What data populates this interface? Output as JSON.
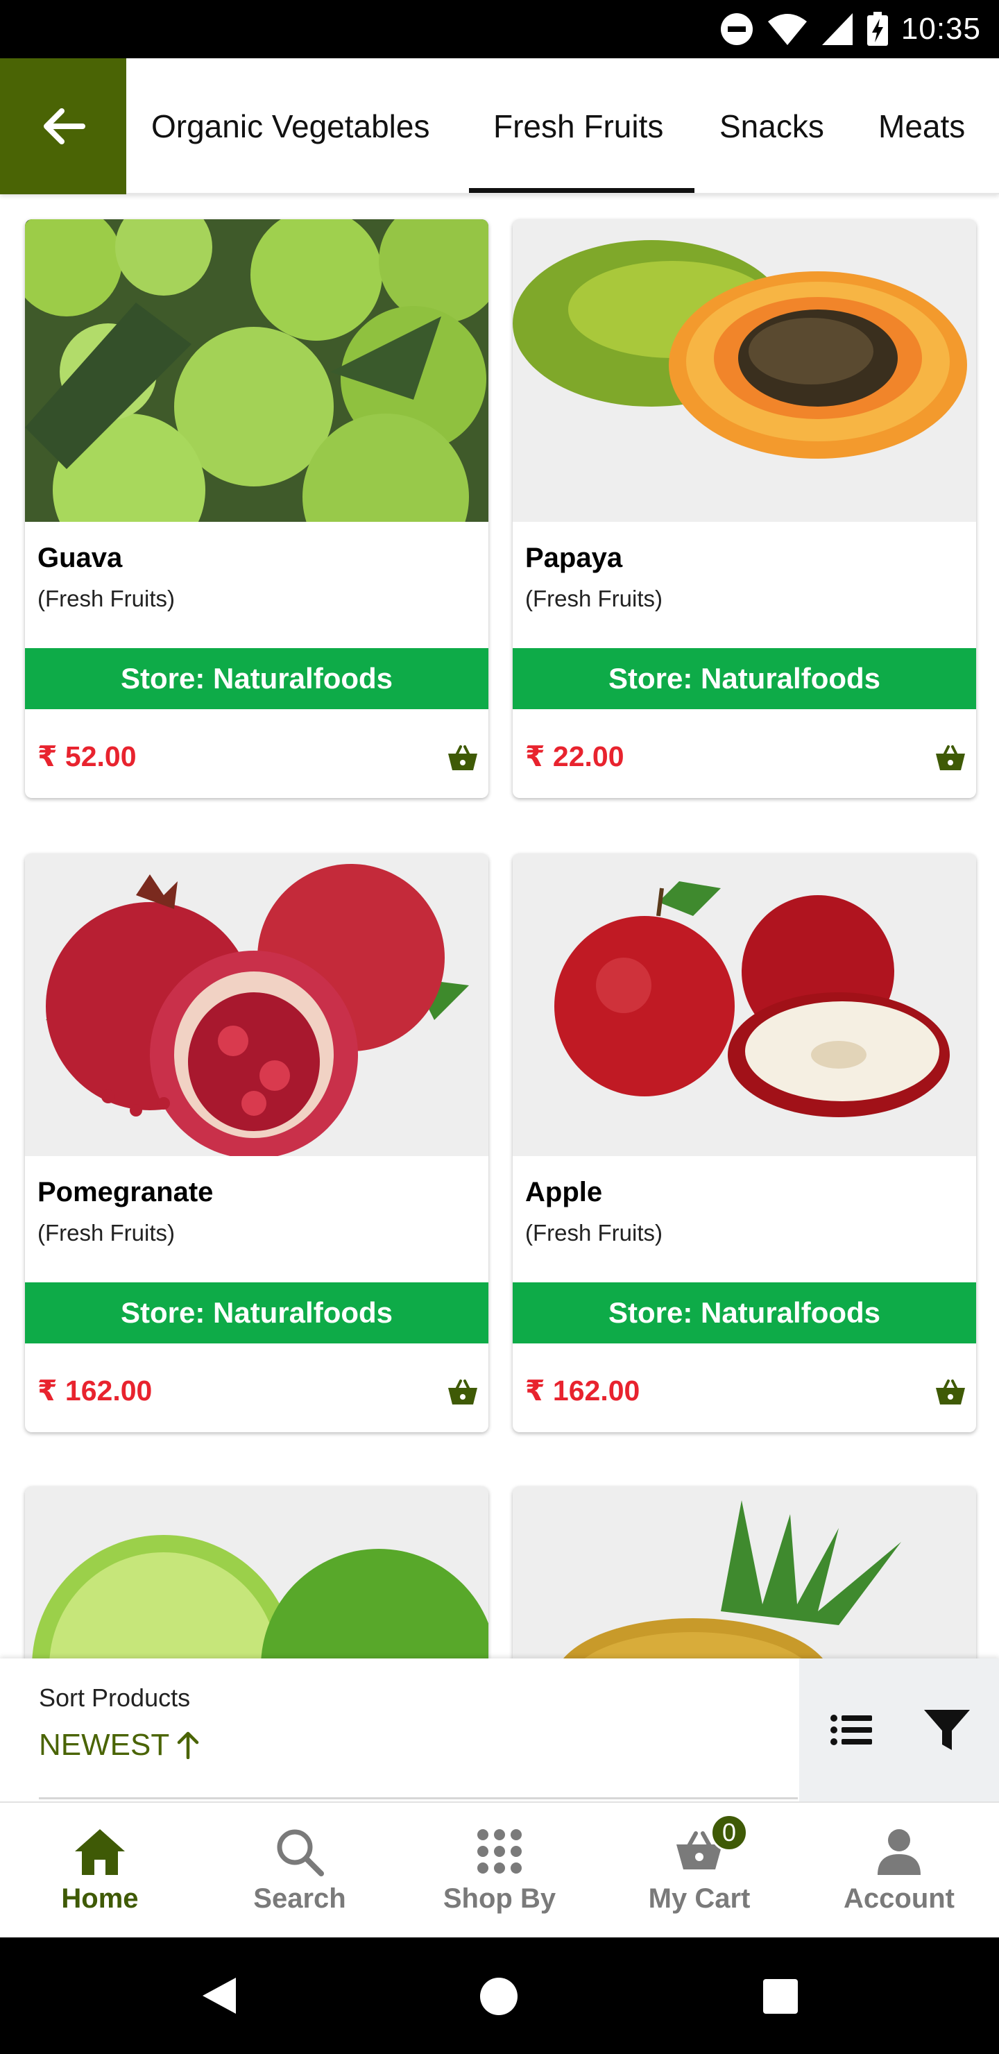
{
  "status_bar": {
    "time": "10:35",
    "icons": [
      "do-not-disturb-icon",
      "wifi-icon",
      "cellular-signal-icon",
      "battery-charging-icon"
    ]
  },
  "category_tabs": {
    "back_icon": "arrow-left-icon",
    "tabs": [
      {
        "label": "Organic Vegetables",
        "active": false
      },
      {
        "label": "Fresh Fruits",
        "active": true
      },
      {
        "label": "Snacks",
        "active": false
      },
      {
        "label": "Meats",
        "active": false
      }
    ]
  },
  "products": [
    {
      "name": "Guava",
      "category": "(Fresh Fruits)",
      "store": "Store: Naturalfoods",
      "price": "₹ 52.00"
    },
    {
      "name": "Papaya",
      "category": "(Fresh Fruits)",
      "store": "Store: Naturalfoods",
      "price": "₹ 22.00"
    },
    {
      "name": "Pomegranate",
      "category": "(Fresh Fruits)",
      "store": "Store: Naturalfoods",
      "price": "₹ 162.00"
    },
    {
      "name": "Apple",
      "category": "(Fresh Fruits)",
      "store": "Store: Naturalfoods",
      "price": "₹ 162.00"
    }
  ],
  "sort": {
    "label": "Sort Products",
    "value": "NEWEST",
    "direction_icon": "arrow-up-icon",
    "tools": [
      "list-view-icon",
      "filter-icon"
    ]
  },
  "bottom_nav": {
    "items": [
      {
        "label": "Home",
        "icon": "home-icon",
        "active": true
      },
      {
        "label": "Search",
        "icon": "search-icon",
        "active": false
      },
      {
        "label": "Shop By",
        "icon": "grid-dots-icon",
        "active": false
      },
      {
        "label": "My Cart",
        "icon": "cart-basket-icon",
        "active": false,
        "badge": "0"
      },
      {
        "label": "Account",
        "icon": "person-icon",
        "active": false
      }
    ]
  },
  "system_nav": {
    "icons": [
      "back-triangle-icon",
      "home-circle-icon",
      "recents-square-icon"
    ]
  },
  "colors": {
    "brand_olive": "#4a6405",
    "store_green": "#0eab48",
    "price_red": "#e8232e",
    "nav_active": "#3f5a06"
  }
}
